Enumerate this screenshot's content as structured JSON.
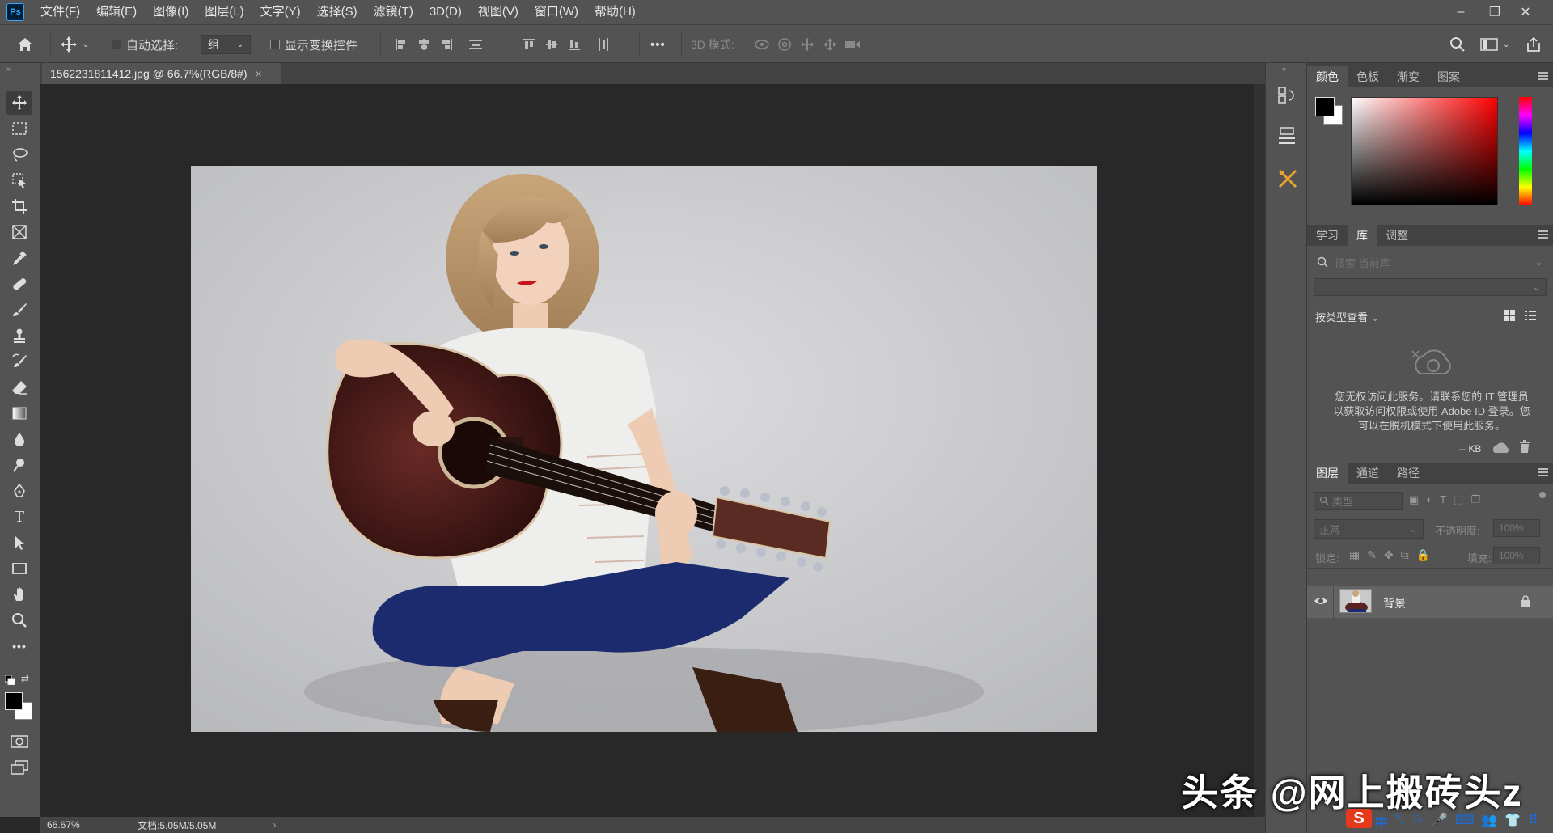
{
  "app": {
    "logo_text": "Ps"
  },
  "menu": [
    "文件(F)",
    "编辑(E)",
    "图像(I)",
    "图层(L)",
    "文字(Y)",
    "选择(S)",
    "滤镜(T)",
    "3D(D)",
    "视图(V)",
    "窗口(W)",
    "帮助(H)"
  ],
  "window_controls": {
    "minimize": "–",
    "restore": "❐",
    "close": "✕"
  },
  "options": {
    "auto_select_label": "自动选择:",
    "auto_select_value": "组",
    "show_transform_label": "显示变换控件",
    "mode_3d_label": "3D 模式:",
    "more": "•••"
  },
  "document": {
    "tab_title": "1562231811412.jpg @ 66.7%(RGB/8#)",
    "tab_close": "×"
  },
  "status": {
    "zoom": "66.67%",
    "doc_size": "文档:5.05M/5.05M",
    "arrow": "›"
  },
  "color_panel": {
    "tabs": [
      "颜色",
      "色板",
      "渐变",
      "图案"
    ],
    "foreground": "#000000",
    "background": "#ffffff",
    "hue_color": "#ff0000"
  },
  "library_panel": {
    "tabs": [
      "学习",
      "库",
      "调整"
    ],
    "search_placeholder": "搜索 当前库",
    "view_label": "按类型查看",
    "message": "您无权访问此服务。请联系您的 IT 管理员以获取访问权限或使用 Adobe ID 登录。您可以在脱机模式下使用此服务。",
    "kb_label": "-- KB"
  },
  "layers_panel": {
    "tabs": [
      "图层",
      "通道",
      "路径"
    ],
    "filter_label": "类型",
    "blend_mode": "正常",
    "opacity_label": "不透明度:",
    "opacity_value": "100%",
    "lock_label": "锁定:",
    "fill_label": "填充:",
    "fill_value": "100%",
    "layers": [
      {
        "name": "背景",
        "visible": true,
        "locked": true
      }
    ]
  },
  "watermark": {
    "text": "头条 @网上搬砖头z",
    "ime_items": [
      "中",
      "°,",
      "☺",
      "🎤",
      "⌨",
      "👥",
      "👕",
      "⠿"
    ]
  }
}
